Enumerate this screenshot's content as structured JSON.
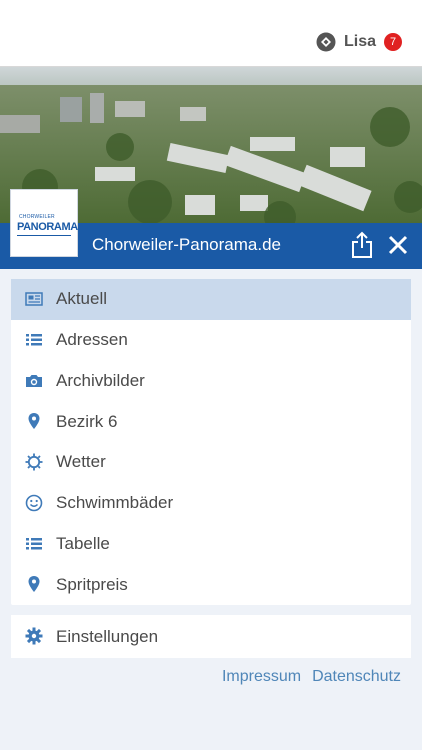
{
  "header": {
    "user_name": "Lisa",
    "notification_count": "7"
  },
  "site": {
    "title": "Chorweiler-Panorama.de",
    "logo_small": "CHORWEILER",
    "logo_big": "PANORAMA"
  },
  "menu": {
    "items": [
      {
        "label": "Aktuell",
        "icon": "newspaper-icon"
      },
      {
        "label": "Adressen",
        "icon": "list-icon"
      },
      {
        "label": "Archivbilder",
        "icon": "camera-icon"
      },
      {
        "label": "Bezirk 6",
        "icon": "location-pin-icon"
      },
      {
        "label": "Wetter",
        "icon": "sun-icon"
      },
      {
        "label": "Schwimmbäder",
        "icon": "smiley-icon"
      },
      {
        "label": "Tabelle",
        "icon": "list-icon"
      },
      {
        "label": "Spritpreis",
        "icon": "location-pin-icon"
      }
    ],
    "settings_label": "Einstellungen"
  },
  "footer": {
    "impressum": "Impressum",
    "datenschutz": "Datenschutz"
  },
  "colors": {
    "brand_blue": "#1a5aa6",
    "active_item": "#c9d9ec",
    "icon_blue": "#3f7ab8",
    "badge_red": "#e02121",
    "link": "#4f86b8"
  }
}
